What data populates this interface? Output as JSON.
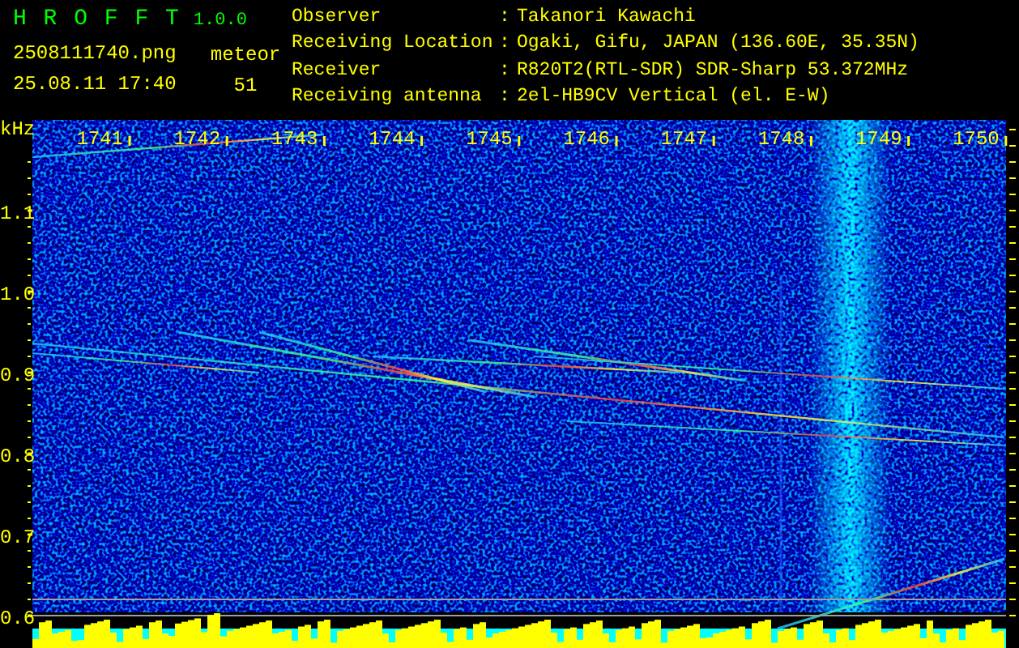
{
  "app": {
    "title": "H R O F F T",
    "version": "1.0.0"
  },
  "file": {
    "name": "2508111740.png",
    "timestamp": "25.08.11 17:40"
  },
  "meteor": {
    "label": "meteor",
    "count": "51"
  },
  "info": [
    {
      "label": "Observer",
      "separator": ":",
      "value": "Takanori Kawachi"
    },
    {
      "label": "Receiving Location",
      "separator": ":",
      "value": "Ogaki, Gifu, JAPAN (136.60E, 35.35N)"
    },
    {
      "label": "Receiver",
      "separator": ":",
      "value": "R820T2(RTL-SDR) SDR-Sharp 53.372MHz"
    },
    {
      "label": "Receiving antenna",
      "separator": ":",
      "value": "2el-HB9CV Vertical (el. E-W)"
    }
  ],
  "spectrogram": {
    "unit": "kHz",
    "x_ticks": [
      "1741",
      "1742",
      "1743",
      "1744",
      "1745",
      "1746",
      "1747",
      "1748",
      "1749",
      "1750"
    ],
    "y_ticks": [
      "1.1",
      "1.0",
      "0.9",
      "0.8",
      "0.7",
      "0.6"
    ]
  }
}
